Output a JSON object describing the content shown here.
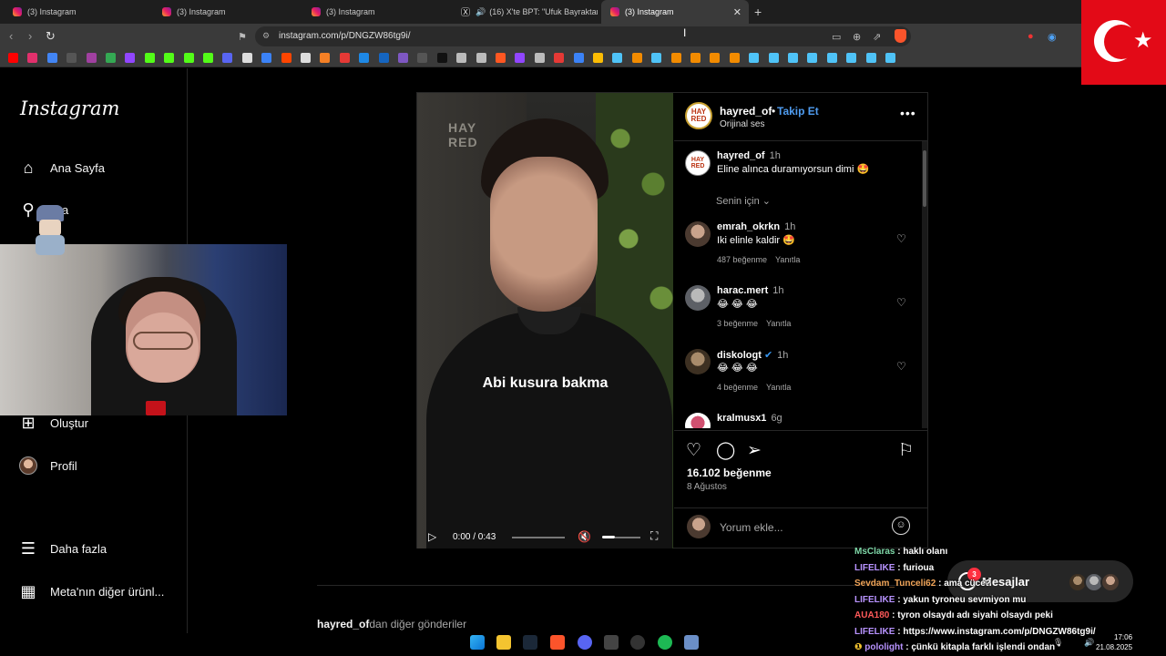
{
  "browser": {
    "tabs": [
      {
        "label": "(3) Instagram",
        "icon": "instagram-icon"
      },
      {
        "label": "(3) Instagram",
        "icon": "instagram-icon"
      },
      {
        "label": "(3) Instagram",
        "icon": "instagram-icon"
      },
      {
        "label": "(16) X'te BPT: \"Ufuk Bayraktar'ın :",
        "icon": "x-icon"
      },
      {
        "label": "(3) Instagram",
        "icon": "instagram-icon",
        "active": true
      }
    ],
    "url": "instagram.com/p/DNGZW86tg9i/",
    "bookmark_colors": [
      "#ff0000",
      "#e1306c",
      "#4285f4",
      "#555",
      "#a040a0",
      "#34a853",
      "#9146ff",
      "#53fc18",
      "#53fc18",
      "#53fc18",
      "#53fc18",
      "#5865f2",
      "#ddd",
      "#3b82f6",
      "#ff4500",
      "#ddd",
      "#f58025",
      "#e53935",
      "#1e88e5",
      "#1565c0",
      "#7e57c2",
      "#555",
      "#111",
      "#bbb",
      "#bbb",
      "#ff5722",
      "#9146ff",
      "#bbb",
      "#e53935",
      "#3b82f6",
      "#fbbc04",
      "#4fc3f7",
      "#f28b00",
      "#4fc3f7",
      "#f28b00",
      "#f28b00",
      "#f28b00",
      "#f28b00",
      "#4fc3f7",
      "#4fc3f7",
      "#4fc3f7",
      "#4fc3f7",
      "#4fc3f7",
      "#4fc3f7",
      "#4fc3f7",
      "#4fc3f7"
    ]
  },
  "sidebar": {
    "logo": "Instagram",
    "items": [
      {
        "label": "Ana Sayfa",
        "icon": "home-icon"
      },
      {
        "label": "Ara",
        "icon": "search-icon"
      },
      {
        "label": "Oluştur",
        "icon": "plus-square-icon"
      },
      {
        "label": "Profil",
        "icon": "profile-avatar"
      },
      {
        "label": "Daha fazla",
        "icon": "menu-icon"
      },
      {
        "label": "Meta'nın diğer ürünl...",
        "icon": "apps-icon"
      }
    ]
  },
  "video": {
    "logo_line1": "HAY",
    "logo_line2": "RED",
    "subtitle": "Abi kusura bakma",
    "time": "0:00 / 0:43"
  },
  "post": {
    "author": "hayred_of",
    "follow_label": "Takip Et",
    "audio": "Orijinal ses",
    "likes": "16.102 beğenme",
    "date": "8 Ağustos",
    "comment_placeholder": "Yorum ekle...",
    "for_you": "Senin için",
    "caption": {
      "user": "hayred_of",
      "time": "1h",
      "text": "Eline alınca duramıyorsun dimi 🤩"
    },
    "comments": [
      {
        "user": "emrah_okrkn",
        "time": "1h",
        "text": "Iki elinle kaldir 🤩",
        "likes": "487 beğenme",
        "reply": "Yanıtla"
      },
      {
        "user": "harac.mert",
        "time": "1h",
        "text": "😂 😂 😂",
        "likes": "3 beğenme",
        "reply": "Yanıtla"
      },
      {
        "user": "diskologt",
        "time": "1h",
        "text": "😂 😂 😂",
        "likes": "4 beğenme",
        "reply": "Yanıtla",
        "verified": true
      },
      {
        "user": "kralmusx1",
        "time": "6g",
        "text": ""
      }
    ],
    "more_from_user": "hayred_of",
    "more_from_suffix": "dan diğer gönderiler"
  },
  "messages": {
    "label": "Mesajlar",
    "badge": "3"
  },
  "chat": [
    {
      "user": "MsClaras",
      "color": "#7ed6a7",
      "text": " : haklı olanı"
    },
    {
      "user": "LIFELIKE",
      "color": "#b893ff",
      "text": " : furioua"
    },
    {
      "user": "Sevdam_Tunceli62",
      "color": "#f2a65a",
      "text": " : ama cüce?"
    },
    {
      "user": "LIFELIKE",
      "color": "#b893ff",
      "text": " : yakun tyroneu sevmiyon mu"
    },
    {
      "user": "AUA180",
      "color": "#ff5a5a",
      "text": " : tyron olsaydı adı siyahi olsaydı peki"
    },
    {
      "user": "LIFELIKE",
      "color": "#b893ff",
      "text": " : https://www.instagram.com/p/DNGZW86tg9i/"
    },
    {
      "user": "pololight",
      "color": "#b893ff",
      "text": " : çünkü kitapla farklı işlendi ondan"
    }
  ],
  "taskbar": {
    "time": "17:06",
    "date": "21.08.2025"
  }
}
